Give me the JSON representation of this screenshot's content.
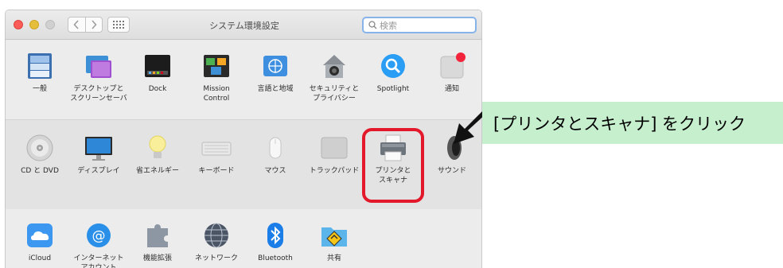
{
  "window": {
    "title": "システム環境設定",
    "search_placeholder": "検索",
    "colors": {
      "close": "#fc5b57",
      "minimize": "#e5bf3c",
      "zoom": "#d0d0d0",
      "search_focus": "#86b4ea"
    }
  },
  "sections": [
    {
      "panes": [
        {
          "label": "一般",
          "icon": "general-icon"
        },
        {
          "label": "デスクトップと\nスクリーンセーバ",
          "icon": "desktop-screensaver-icon"
        },
        {
          "label": "Dock",
          "icon": "dock-icon"
        },
        {
          "label": "Mission\nControl",
          "icon": "mission-control-icon"
        },
        {
          "label": "言語と地域",
          "icon": "language-region-icon"
        },
        {
          "label": "セキュリティと\nプライバシー",
          "icon": "security-privacy-icon"
        },
        {
          "label": "Spotlight",
          "icon": "spotlight-icon"
        },
        {
          "label": "通知",
          "icon": "notifications-icon"
        }
      ]
    },
    {
      "panes": [
        {
          "label": "CD と DVD",
          "icon": "cd-dvd-icon"
        },
        {
          "label": "ディスプレイ",
          "icon": "display-icon"
        },
        {
          "label": "省エネルギー",
          "icon": "energy-saver-icon"
        },
        {
          "label": "キーボード",
          "icon": "keyboard-icon"
        },
        {
          "label": "マウス",
          "icon": "mouse-icon"
        },
        {
          "label": "トラックパッド",
          "icon": "trackpad-icon"
        },
        {
          "label": "プリンタと\nスキャナ",
          "icon": "printer-scanner-icon"
        },
        {
          "label": "サウンド",
          "icon": "sound-icon"
        }
      ]
    },
    {
      "panes": [
        {
          "label": "iCloud",
          "icon": "icloud-icon"
        },
        {
          "label": "インターネット\nアカウント",
          "icon": "internet-accounts-icon"
        },
        {
          "label": "機能拡張",
          "icon": "extensions-icon"
        },
        {
          "label": "ネットワーク",
          "icon": "network-icon"
        },
        {
          "label": "Bluetooth",
          "icon": "bluetooth-icon"
        },
        {
          "label": "共有",
          "icon": "sharing-icon"
        }
      ]
    }
  ],
  "annotation": {
    "text": "[プリンタとスキャナ] をクリック",
    "highlight_color": "#e3182b",
    "callout_color": "#c6efce"
  }
}
